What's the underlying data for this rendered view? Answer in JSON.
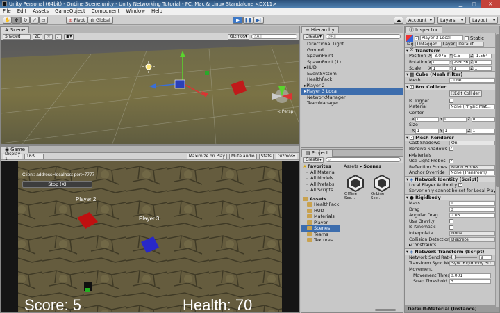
{
  "titlebar": {
    "title": "Unity Personal (64bit) - OnLine Scene.unity - Unity Networking Tutorial - PC, Mac & Linux Standalone <DX11>"
  },
  "menu": [
    "File",
    "Edit",
    "Assets",
    "GameObject",
    "Component",
    "Window",
    "Help"
  ],
  "toolbar": {
    "pivot": "Pivot",
    "global": "Global",
    "account": "Account",
    "layers": "Layers",
    "layout": "Layout"
  },
  "scene": {
    "tab": "Scene",
    "shading": "Shaded",
    "mode2d": "2D",
    "gizmos": "Gizmos",
    "search": "All",
    "persp": "< Persp"
  },
  "game": {
    "tab": "Game",
    "display": "Display 1",
    "aspect": "16:9",
    "maximize": "Maximize on Play",
    "mute": "Mute audio",
    "stats": "Stats",
    "gizmos": "Gizmos",
    "client_info": "Client: address=localhost port=7777",
    "stop": "Stop (X)",
    "player2": "Player 2",
    "player3": "Player 3",
    "score": "Score: 5",
    "health": "Health: 70"
  },
  "hierarchy": {
    "tab": "Hierarchy",
    "create": "Create",
    "search": "All",
    "items": [
      "Directional Light",
      "Ground",
      "SpawnPoint",
      "SpawnPoint (1)",
      "HUD",
      "EventSystem",
      "HealthPack",
      "Player 2",
      "Player 3 Local",
      "NetworkManager",
      "TeamManager"
    ]
  },
  "project": {
    "tab": "Project",
    "create": "Create",
    "favorites": "Favorites",
    "fav_items": [
      "All Material",
      "All Models",
      "All Prefabs",
      "All Scripts"
    ],
    "assets": "Assets",
    "asset_items": [
      "HealthPack",
      "HUD",
      "Materials",
      "Player",
      "Scenes",
      "Teams",
      "Textures"
    ],
    "breadcrumb": [
      "Assets",
      "Scenes"
    ],
    "scenes": [
      "Offline Sce...",
      "OnLine Sce..."
    ]
  },
  "inspector": {
    "tab": "Inspector",
    "object_name": "Player 3 Local",
    "static": "Static",
    "tag_label": "Tag",
    "tag": "Untagged",
    "layer_label": "Layer",
    "layer": "Default",
    "transform": {
      "title": "Transform",
      "position": "Position",
      "rotation": "Rotation",
      "scale": "Scale",
      "pos": [
        "-3.075",
        "0.5",
        "-1.564"
      ],
      "rot": [
        "0",
        "299.36",
        "0"
      ],
      "scl": [
        "1",
        "1",
        "1"
      ]
    },
    "mesh_filter": {
      "title": "Cube (Mesh Filter)",
      "mesh_label": "Mesh",
      "mesh": "Cube"
    },
    "box_collider": {
      "title": "Box Collider",
      "edit": "Edit Collider",
      "is_trigger": "Is Trigger",
      "material": "Material",
      "material_val": "None (Physic Mat...",
      "center": "Center",
      "center_v": [
        "0",
        "0",
        "0"
      ],
      "size": "Size",
      "size_v": [
        "1",
        "1",
        "1"
      ]
    },
    "mesh_renderer": {
      "title": "Mesh Renderer",
      "cast": "Cast Shadows",
      "cast_val": "On",
      "receive": "Receive Shadows",
      "materials": "Materials",
      "light_probes": "Use Light Probes",
      "refl": "Reflection Probes",
      "refl_val": "Blend Probes",
      "anchor": "Anchor Override",
      "anchor_val": "None (Transform)"
    },
    "network_identity": {
      "title": "Network Identity (Script)",
      "local_auth": "Local Player Authority",
      "note": "Server-only cannot be set for Local Player"
    },
    "rigidbody": {
      "title": "Rigidbody",
      "mass": "Mass",
      "mass_v": "1",
      "drag": "Drag",
      "drag_v": "0",
      "ang": "Angular Drag",
      "ang_v": "0.05",
      "grav": "Use Gravity",
      "kin": "Is Kinematic",
      "interp": "Interpolate",
      "interp_v": "None",
      "coll": "Collision Detection",
      "coll_v": "Discrete",
      "constraints": "Constraints"
    },
    "network_transform": {
      "title": "Network Transform (Script)",
      "rate": "Network Send Rate",
      "rate_v": "9",
      "sync": "Transform Sync Mode",
      "sync_v": "Sync Rigidbody 3D",
      "movement": "Movement:",
      "thresh": "Movement Thresh",
      "thresh_v": "0.001",
      "snap": "Snap Threshold",
      "snap_v": "5"
    },
    "footer": "Default-Material (Instance)"
  }
}
